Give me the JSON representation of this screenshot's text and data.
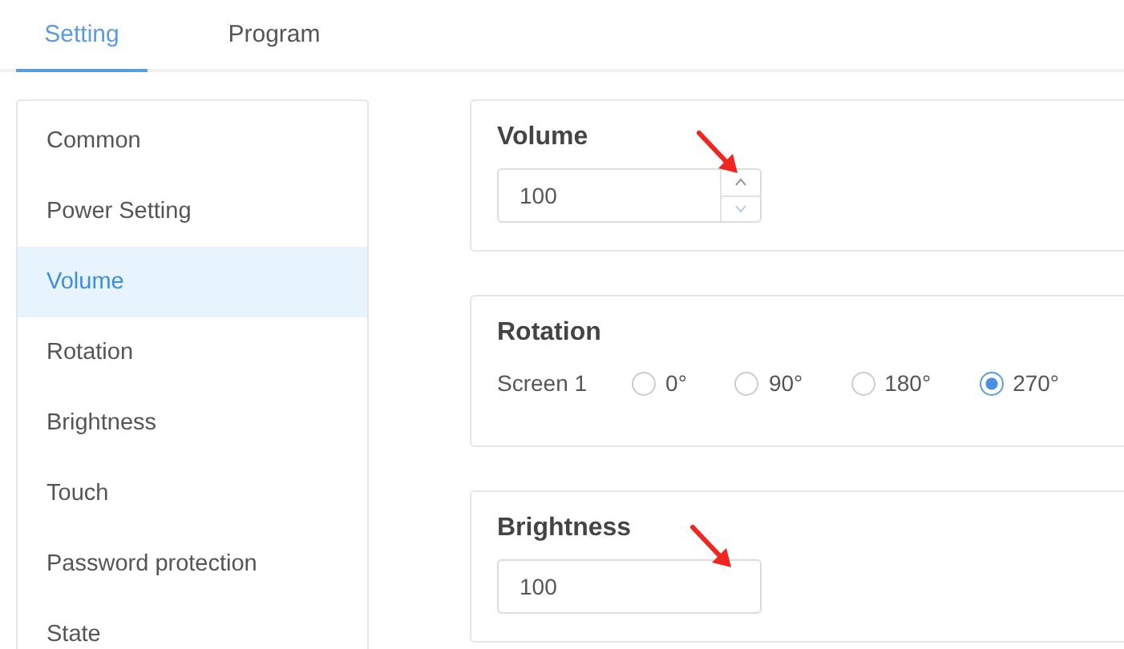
{
  "tabs": [
    {
      "label": "Setting",
      "selected": true
    },
    {
      "label": "Program",
      "selected": false
    }
  ],
  "sidebar": {
    "items": [
      {
        "label": "Common",
        "selected": false
      },
      {
        "label": "Power Setting",
        "selected": false
      },
      {
        "label": "Volume",
        "selected": true
      },
      {
        "label": "Rotation",
        "selected": false
      },
      {
        "label": "Brightness",
        "selected": false
      },
      {
        "label": "Touch",
        "selected": false
      },
      {
        "label": "Password protection",
        "selected": false
      },
      {
        "label": "State",
        "selected": false
      }
    ]
  },
  "sections": [
    {
      "kind": "number",
      "title": "Volume",
      "value": "100",
      "pointer": true
    },
    {
      "kind": "radio",
      "title": "Rotation",
      "label": "Screen 1",
      "options": [
        {
          "label": "0°",
          "selected": false
        },
        {
          "label": "90°",
          "selected": false
        },
        {
          "label": "180°",
          "selected": false
        },
        {
          "label": "270°",
          "selected": true
        }
      ]
    },
    {
      "kind": "text",
      "title": "Brightness",
      "value": "100",
      "pointer": true
    }
  ]
}
